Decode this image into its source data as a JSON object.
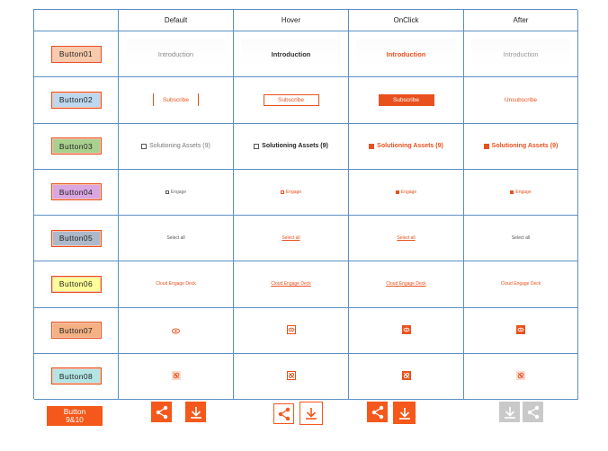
{
  "headers": [
    "",
    "Default",
    "Hover",
    "OnClick",
    "After"
  ],
  "rows": [
    {
      "label": "Button01",
      "color": "#f8cbad",
      "default": "Introduction",
      "hover": "Introduction",
      "onclick": "Introduction",
      "after": "Introduction"
    },
    {
      "label": "Button02",
      "color": "#bdd7ee",
      "default": "Subscribe",
      "hover": "Subscribe",
      "onclick": "Subscribe",
      "after": "Unsubscribe"
    },
    {
      "label": "Button03",
      "color": "#a9d18e",
      "default": "Solutioning Assets (9)",
      "hover": "Solutioning Assets (9)",
      "onclick": "Solutioning Assets (9)",
      "after": "Solutioning Assets (9)"
    },
    {
      "label": "Button04",
      "color": "#d9a6e0",
      "default": "Engage",
      "hover": "Engage",
      "onclick": "Engage",
      "after": "Engage"
    },
    {
      "label": "Button05",
      "color": "#adb9ca",
      "default": "Select all",
      "hover": "Select all",
      "onclick": "Select all",
      "after": "Select all"
    },
    {
      "label": "Button06",
      "color": "#ffff99",
      "default": "Cloud Engage Deck",
      "hover": "Cloud Engage Deck",
      "onclick": "Cloud Engage Deck",
      "after": "Cloud Engage Deck"
    },
    {
      "label": "Button07",
      "color": "#f4b183",
      "icons": [
        "eye-icon",
        "eye-icon",
        "eye-icon",
        "eye-icon"
      ]
    },
    {
      "label": "Button08",
      "color": "#b4e5e5",
      "icons": [
        "link-off-icon",
        "link-off-icon",
        "link-off-icon",
        "link-off-icon"
      ]
    }
  ],
  "bottom": {
    "button_line1": "Button",
    "button_line2": "9&10",
    "icons": [
      "share-icon",
      "download-icon"
    ]
  },
  "colors": {
    "accent": "#e8511e",
    "grid": "#5b8fc4",
    "disabled": "#c9c9c9"
  }
}
